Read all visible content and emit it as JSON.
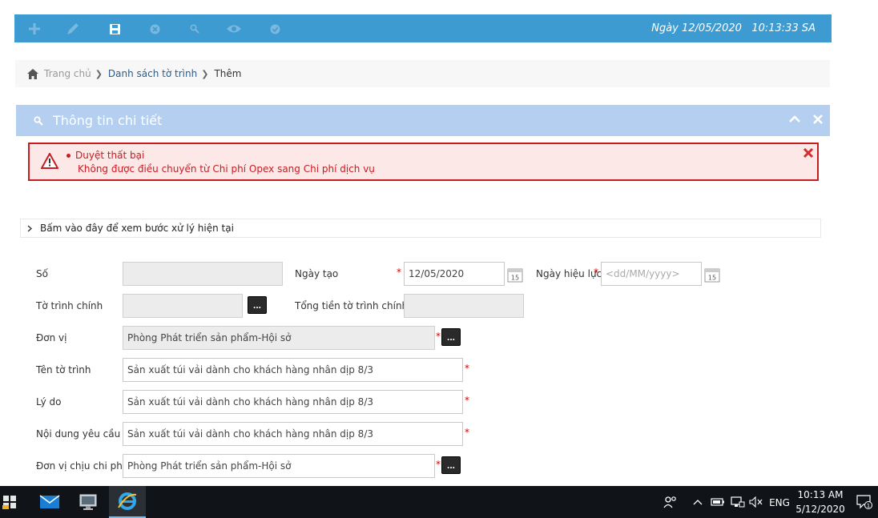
{
  "toolbar": {
    "datetime": "Ngày 12/05/2020   10:13:33 SA",
    "icons": [
      "add-icon",
      "edit-icon",
      "save-icon",
      "cancel-icon",
      "search-icon",
      "view-icon",
      "approve-icon"
    ]
  },
  "breadcrumb": {
    "home": "Trang chủ",
    "list": "Danh sách tờ trình",
    "current": "Thêm"
  },
  "panel": {
    "title": "Thông tin chi tiết"
  },
  "error": {
    "title": "Duyệt thất bại",
    "message": "Không được điều chuyển từ Chi phí Opex sang Chi phí dịch vụ"
  },
  "collapse": {
    "label": "Bấm vào đây để xem bước xử lý hiện tại"
  },
  "form": {
    "so_label": "Số",
    "so_value": "",
    "ngay_tao_label": "Ngày tạo",
    "ngay_tao_value": "12/05/2020",
    "ngay_hieu_luc_label": "Ngày hiệu lực",
    "ngay_hieu_luc_placeholder": "<dd/MM/yyyy>",
    "to_trinh_chinh_label": "Tờ trình chính",
    "to_trinh_chinh_value": "",
    "tong_tien_label": "Tổng tiền tờ trình chính",
    "tong_tien_value": "",
    "don_vi_label": "Đơn vị",
    "don_vi_value": "Phòng Phát triển sản phẩm-Hội sở",
    "ten_to_trinh_label": "Tên tờ trình",
    "ten_to_trinh_value": "Sản xuất túi vải dành cho khách hàng nhân dịp 8/3",
    "ly_do_label": "Lý do",
    "ly_do_value": "Sản xuất túi vải dành cho khách hàng nhân dịp 8/3",
    "noi_dung_label": "Nội dung yêu cầu",
    "noi_dung_value": "Sản xuất túi vải dành cho khách hàng nhân dịp 8/3",
    "don_vi_chiu_label": "Đơn vị chịu chi phí",
    "don_vi_chiu_value": "Phòng Phát triển sản phẩm-Hội sở",
    "required_mark": "*",
    "ellipsis": "...",
    "calendar_day": "15"
  },
  "taskbar": {
    "lang": "ENG",
    "time": "10:13 AM",
    "date": "5/12/2020",
    "notification_count": "1"
  }
}
